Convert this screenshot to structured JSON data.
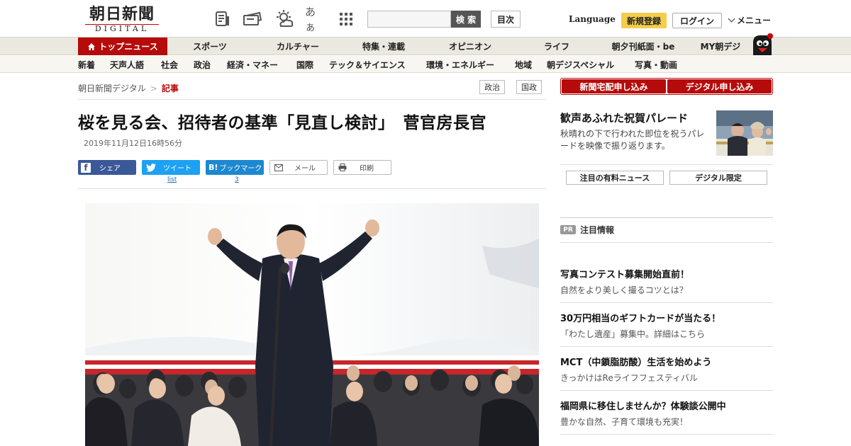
{
  "header": {
    "logo_main": "朝日新聞",
    "logo_sub": "DIGITAL",
    "icons": [
      "newspaper-icon",
      "tickets-icon",
      "weather-icon",
      "font-size-icon",
      "apps-grid-icon"
    ],
    "font_size_label": "あぁ",
    "search_placeholder": "",
    "search_button": "検 索",
    "toc_button": "目次",
    "language": "Language",
    "register": "新規登録",
    "login": "ログイン",
    "menu": "メニュー"
  },
  "nav_primary": [
    {
      "label": "トップニュース",
      "active": true
    },
    {
      "label": "スポーツ"
    },
    {
      "label": "カルチャー"
    },
    {
      "label": "特集・連載"
    },
    {
      "label": "オピニオン"
    },
    {
      "label": "ライフ"
    },
    {
      "label": "朝夕刊紙面・be"
    },
    {
      "label": "MY朝デジ"
    }
  ],
  "nav_secondary": [
    "新着",
    "天声人語",
    "社会",
    "政治",
    "経済・マネー",
    "国際",
    "テック＆サイエンス",
    "環境・エネルギー",
    "地域",
    "朝デジスペシャル",
    "写真・動画"
  ],
  "article": {
    "breadcrumb_home": "朝日新聞デジタル",
    "breadcrumb_sep": ">",
    "breadcrumb_current": "記事",
    "tags": [
      "政治",
      "国政"
    ],
    "headline": "桜を見る会、招待者の基準「見直し検討」　菅官房長官",
    "date": "2019年11月12日16時56分",
    "share": {
      "facebook": "シェア",
      "twitter": "ツイート",
      "twitter_count": "list",
      "hatena": "ブックマーク",
      "hatena_count": "3",
      "mail": "メール",
      "print": "印刷"
    }
  },
  "sidebar": {
    "promo": [
      "新聞宅配申し込み",
      "デジタル申し込み"
    ],
    "feature": {
      "title": "歓声あふれた祝賀パレード",
      "desc": "秋晴れの下で行われた即位を祝うパレードを映像で振り返ります。"
    },
    "tabs": [
      "注目の有料ニュース",
      "デジタル限定"
    ],
    "pr_badge": "PR",
    "pr_title": "注目情報",
    "ads": [
      {
        "title": "写真コンテスト募集開始直前！",
        "desc": "自然をより美しく撮るコツとは？"
      },
      {
        "title": "30万円相当のギフトカードが当たる！",
        "desc": "「わたし遺産」募集中。詳細はこちら"
      },
      {
        "title": "MCT（中鎖脂肪酸）生活を始めよう",
        "desc": "きっかけはReライフフェスティバル"
      },
      {
        "title": "福岡県に移住しませんか？体験談公開中",
        "desc": "豊かな自然、子育て環境も充実！"
      }
    ]
  },
  "colors": {
    "brand_red": "#b60b0b",
    "register_yellow": "#f5cd4a",
    "nav_bg": "#ebe8e0"
  }
}
